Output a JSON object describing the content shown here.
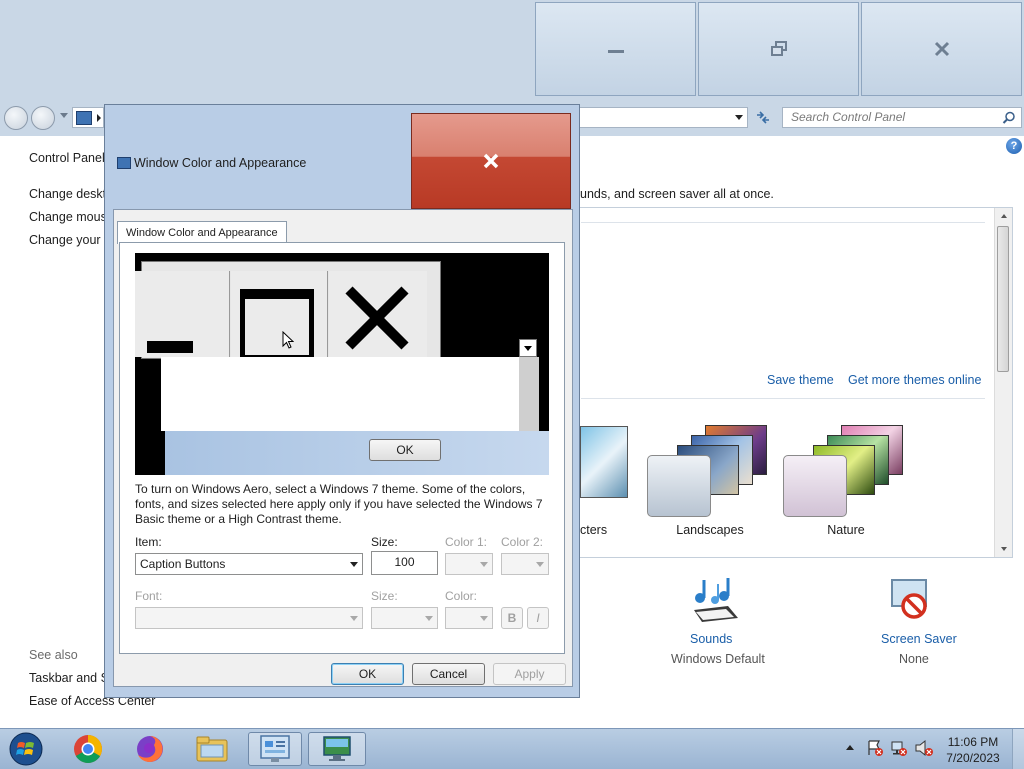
{
  "background_window": {
    "search_placeholder": "Search Control Panel",
    "left_nav": {
      "home": "Control Panel",
      "links": [
        "Change deskto",
        "Change mous",
        "Change your a"
      ],
      "see_also_heading": "See also",
      "see_also": [
        "Taskbar and St",
        "Ease of Access Center"
      ]
    },
    "intro_text": "unds, and screen saver all at once.",
    "save_theme": "Save theme",
    "get_more_themes": "Get more themes online",
    "themes": [
      "cters",
      "Landscapes",
      "Nature"
    ],
    "bottom_items": [
      {
        "label": "Sounds",
        "value": "Windows Default"
      },
      {
        "label": "Screen Saver",
        "value": "None"
      }
    ]
  },
  "dialog": {
    "title": "Window Color and Appearance",
    "tab": "Window Color and Appearance",
    "preview_ok": "OK",
    "description": "To turn on Windows Aero, select a Windows 7 theme.  Some of the colors, fonts, and sizes selected here apply only if you have selected the Windows 7 Basic theme or a High Contrast theme.",
    "item_label": "Item:",
    "item_value": "Caption Buttons",
    "size_label": "Size:",
    "size_value": "100",
    "color1_label": "Color 1:",
    "color2_label": "Color 2:",
    "font_label": "Font:",
    "font_size_label": "Size:",
    "font_color_label": "Color:",
    "bold_label": "B",
    "italic_label": "I",
    "ok": "OK",
    "cancel": "Cancel",
    "apply": "Apply"
  },
  "taskbar": {
    "time": "11:06 PM",
    "date": "7/20/2023",
    "pinned": [
      "start-orb-icon",
      "chrome-icon",
      "firefox-icon",
      "file-explorer-icon",
      "control-panel-icon",
      "display-settings-icon"
    ]
  },
  "colors": {
    "close_red": "#c44833",
    "link_blue": "#1a5ea8",
    "frame_blue": "#b9cde6"
  }
}
